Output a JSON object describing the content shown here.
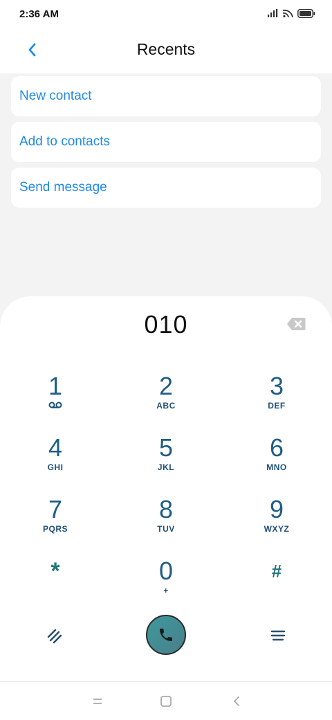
{
  "status_bar": {
    "time": "2:36 AM"
  },
  "header": {
    "title": "Recents"
  },
  "actions": [
    {
      "label": "New contact"
    },
    {
      "label": "Add to contacts"
    },
    {
      "label": "Send message"
    }
  ],
  "dialpad": {
    "number": "010",
    "keys": [
      {
        "digit": "1",
        "letters": ""
      },
      {
        "digit": "2",
        "letters": "ABC"
      },
      {
        "digit": "3",
        "letters": "DEF"
      },
      {
        "digit": "4",
        "letters": "GHI"
      },
      {
        "digit": "5",
        "letters": "JKL"
      },
      {
        "digit": "6",
        "letters": "MNO"
      },
      {
        "digit": "7",
        "letters": "PQRS"
      },
      {
        "digit": "8",
        "letters": "TUV"
      },
      {
        "digit": "9",
        "letters": "WXYZ"
      },
      {
        "digit": "*",
        "letters": ""
      },
      {
        "digit": "0",
        "letters": "+"
      },
      {
        "digit": "#",
        "letters": ""
      }
    ]
  },
  "colors": {
    "accent": "#1f8be6",
    "digit": "#1e5e86",
    "call": "#3d9a9c"
  },
  "icons": [
    "signal-icon",
    "wifi-icon",
    "battery-icon",
    "back-icon",
    "backspace-icon",
    "voicemail-icon",
    "slash-icon",
    "call-icon",
    "menu-icon",
    "recents-nav-icon",
    "home-nav-icon",
    "back-nav-icon"
  ]
}
